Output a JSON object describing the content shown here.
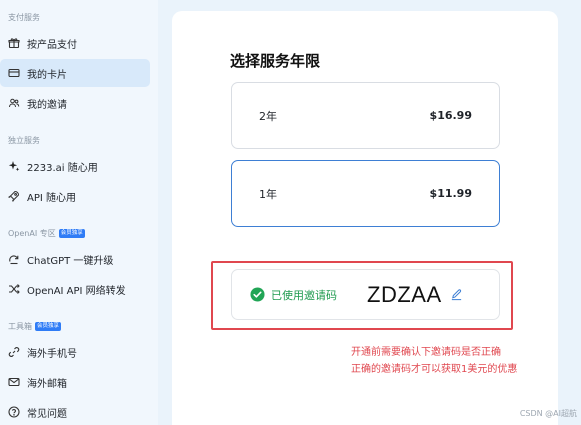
{
  "sidebar": {
    "sections": [
      {
        "label": "支付服务"
      },
      {
        "label": "独立服务"
      },
      {
        "label": "OpenAI 专区",
        "badge": "会员独享"
      },
      {
        "label": "工具箱",
        "badge": "会员独享"
      }
    ],
    "items": [
      {
        "label": "按产品支付",
        "icon": "gift-icon"
      },
      {
        "label": "我的卡片",
        "icon": "card-icon",
        "active": true
      },
      {
        "label": "我的邀请",
        "icon": "users-icon"
      },
      {
        "label": "2233.ai 随心用",
        "icon": "sparkle-icon"
      },
      {
        "label": "API 随心用",
        "icon": "rocket-icon"
      },
      {
        "label": "ChatGPT 一键升级",
        "icon": "upgrade-icon"
      },
      {
        "label": "OpenAI API 网络转发",
        "icon": "shuffle-icon"
      },
      {
        "label": "海外手机号",
        "icon": "link-icon"
      },
      {
        "label": "海外邮箱",
        "icon": "mail-icon"
      },
      {
        "label": "常见问题",
        "icon": "help-icon"
      }
    ]
  },
  "main": {
    "title": "选择服务年限",
    "plans": [
      {
        "name": "2年",
        "price": "$16.99",
        "selected": false
      },
      {
        "name": "1年",
        "price": "$11.99",
        "selected": true
      }
    ],
    "invite": {
      "status_label": "已使用邀请码",
      "code": "ZDZAA"
    }
  },
  "annotation": {
    "line1": "开通前需要确认下邀请码是否正确",
    "line2": "正确的邀请码才可以获取1美元的优惠"
  },
  "watermark": "CSDN @AI超航",
  "colors": {
    "accent": "#2f7cf6",
    "selected_border": "#3e7fd4",
    "success": "#1f9b4f",
    "annotation_red": "#e0474f"
  }
}
